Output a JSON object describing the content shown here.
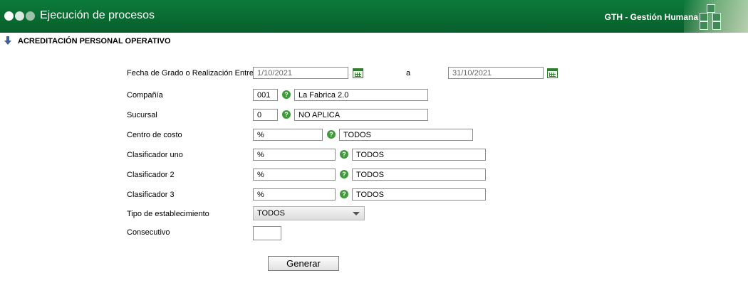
{
  "header": {
    "title": "Ejecución de procesos",
    "module": "GTH - Gestión Humana"
  },
  "section": {
    "title": "ACREDITACIÓN PERSONAL OPERATIVO"
  },
  "form": {
    "fecha": {
      "label": "Fecha de Grado o Realización Entre:",
      "from": "1/10/2021",
      "separator": "a",
      "to": "31/10/2021"
    },
    "compania": {
      "label": "Compañía",
      "code": "001",
      "name": "La Fabrica 2.0"
    },
    "sucursal": {
      "label": "Sucursal",
      "code": "0",
      "name": "NO APLICA"
    },
    "centro_costo": {
      "label": "Centro de costo",
      "code": "%",
      "name": "TODOS"
    },
    "clasificador_uno": {
      "label": "Clasificador uno",
      "code": "%",
      "name": "TODOS"
    },
    "clasificador_2": {
      "label": "Clasificador 2",
      "code": "%",
      "name": "TODOS"
    },
    "clasificador_3": {
      "label": "Clasificador 3",
      "code": "%",
      "name": "TODOS"
    },
    "tipo_establecimiento": {
      "label": "Tipo de establecimiento",
      "selected": "TODOS"
    },
    "consecutivo": {
      "label": "Consecutivo",
      "value": ""
    },
    "help_glyph": "?",
    "generate_label": "Generar"
  }
}
